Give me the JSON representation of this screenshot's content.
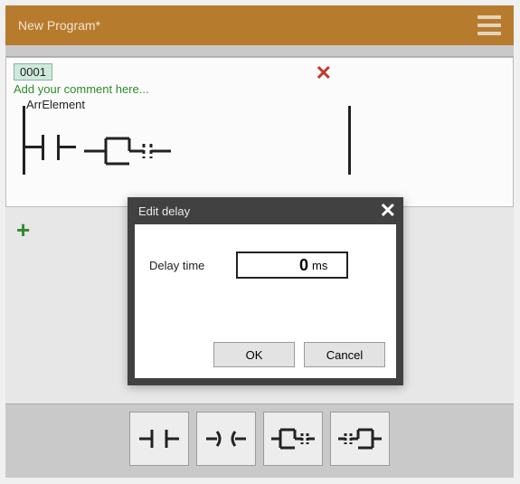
{
  "titlebar": {
    "title": "New Program*"
  },
  "rung": {
    "number": "0001",
    "comment_placeholder": "Add your comment here...",
    "element_label": "ArrElement"
  },
  "dialog": {
    "title": "Edit delay",
    "field_label": "Delay time",
    "value": "0",
    "unit": "ms",
    "ok": "OK",
    "cancel": "Cancel"
  }
}
